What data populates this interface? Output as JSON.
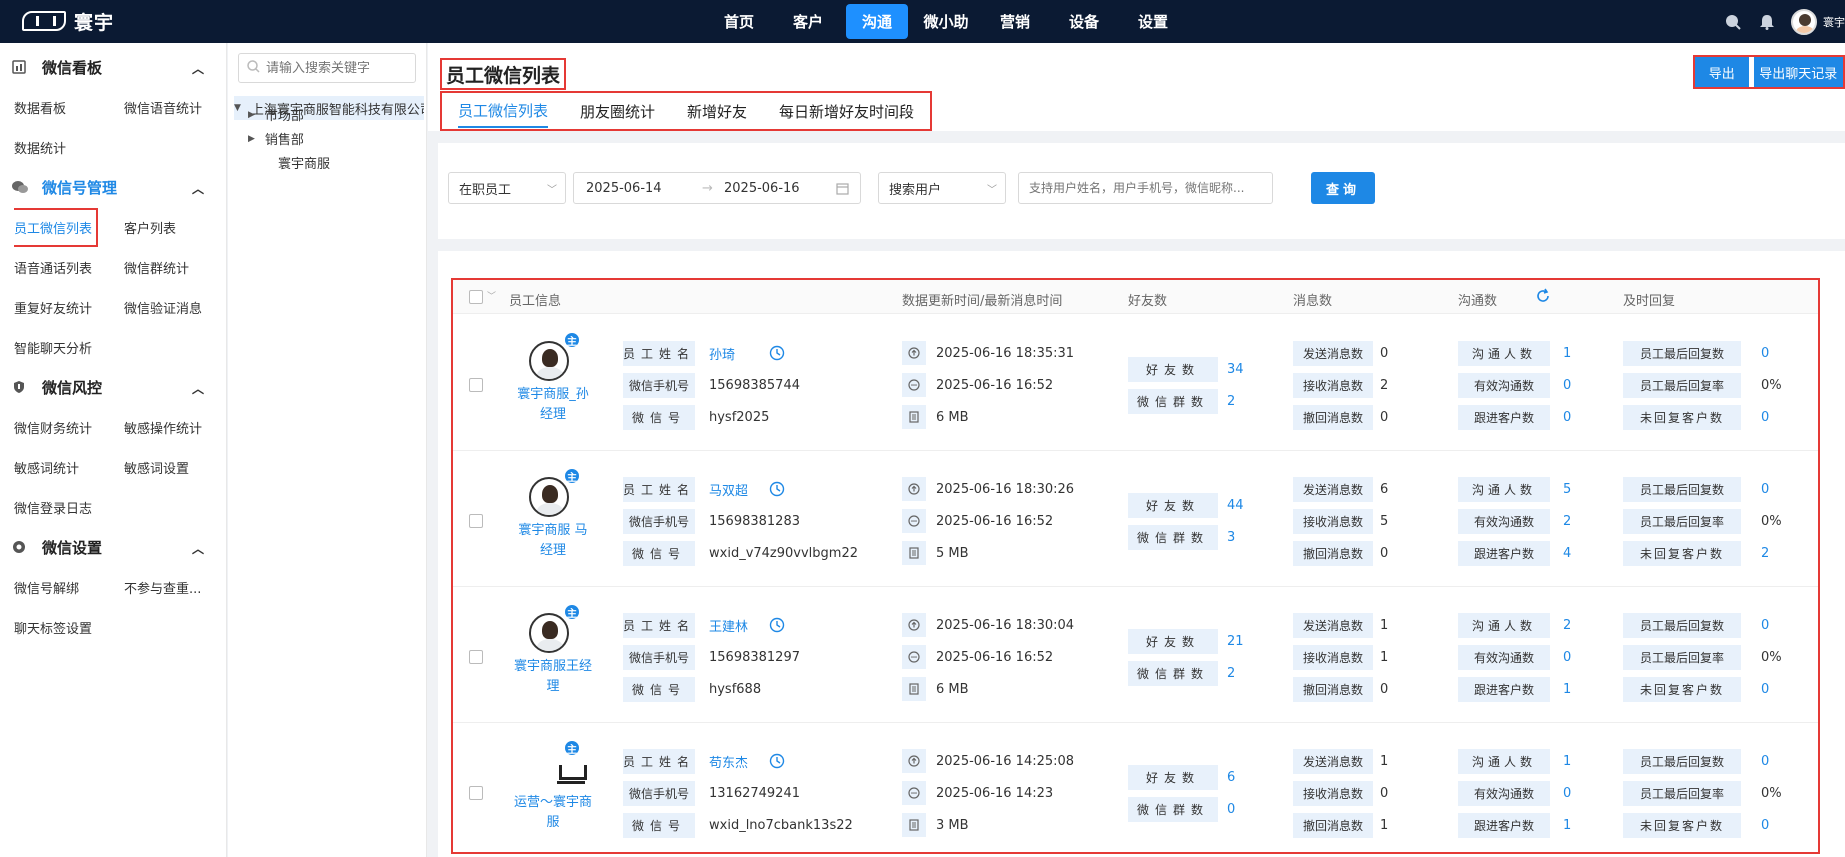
{
  "topnav": {
    "brand": "寰宇",
    "links": [
      "首页",
      "客户",
      "沟通",
      "微小助",
      "营销",
      "设备",
      "设置"
    ],
    "active": "沟通",
    "user": "寰宇商服"
  },
  "sidebar": {
    "sections": [
      {
        "title": "微信看板",
        "items": [
          "数据看板",
          "微信语音统计",
          "数据统计"
        ]
      },
      {
        "title": "微信号管理",
        "items": [
          "员工微信列表",
          "客户列表",
          "语音通话列表",
          "微信群统计",
          "重复好友统计",
          "微信验证消息",
          "智能聊天分析"
        ]
      },
      {
        "title": "微信风控",
        "items": [
          "微信财务统计",
          "敏感操作统计",
          "敏感词统计",
          "敏感词设置",
          "微信登录日志"
        ]
      },
      {
        "title": "微信设置",
        "items": [
          "微信号解绑",
          "不参与查重...",
          "聊天标签设置"
        ]
      }
    ],
    "active_item": "员工微信列表"
  },
  "tree": {
    "search_placeholder": "请输入搜索关键字",
    "root": "上海寰宇商服智能科技有限公司",
    "children": [
      "市场部",
      "销售部",
      "寰宇商服"
    ]
  },
  "page": {
    "title": "员工微信列表",
    "tabs": [
      "员工微信列表",
      "朋友圈统计",
      "新增好友",
      "每日新增好友时间段"
    ],
    "export_label": "导出",
    "export_chat_label": "导出聊天记录"
  },
  "filters": {
    "status": "在职员工",
    "date_start": "2025-06-14",
    "date_end": "2025-06-16",
    "date_sep": "→",
    "search_type": "搜索用户",
    "search_placeholder": "支持用户姓名，用户手机号，微信昵称...",
    "query_label": "查询"
  },
  "table": {
    "headers": [
      "员工信息",
      "数据更新时间/最新消息时间",
      "好友数",
      "消息数",
      "沟通数",
      "及时回复"
    ],
    "labels": {
      "name": "员工姓名",
      "phone": "微信手机号",
      "wxid": "微信号",
      "friends": "好友数",
      "groups": "微信群数",
      "sent": "发送消息数",
      "received": "接收消息数",
      "recalled": "撤回消息数",
      "contacts": "沟通人数",
      "effective": "有效沟通数",
      "followed": "跟进客户数",
      "last_reply": "员工最后回复数",
      "reply_rate": "员工最后回复率",
      "unreplied": "未回复客户数"
    },
    "badge": "主",
    "rows": [
      {
        "nick": "寰宇商服_孙经理",
        "avatar": "person",
        "name": "孙琦",
        "phone": "15698385744",
        "wxid": "hysf2025",
        "updated": "2025-06-16 18:35:31",
        "last_msg": "2025-06-16 16:52",
        "size": "6 MB",
        "friends": "34",
        "groups": "2",
        "sent": "0",
        "received": "2",
        "recalled": "0",
        "contacts": "1",
        "effective": "0",
        "followed": "0",
        "last_reply": "0",
        "reply_rate": "0%",
        "unreplied": "0"
      },
      {
        "nick": "寰宇商服 马经理",
        "avatar": "person",
        "name": "马双超",
        "phone": "15698381283",
        "wxid": "wxid_v74z90vvlbgm22",
        "updated": "2025-06-16 18:30:26",
        "last_msg": "2025-06-16 16:52",
        "size": "5 MB",
        "friends": "44",
        "groups": "3",
        "sent": "6",
        "received": "5",
        "recalled": "0",
        "contacts": "5",
        "effective": "2",
        "followed": "4",
        "last_reply": "0",
        "reply_rate": "0%",
        "unreplied": "2"
      },
      {
        "nick": "寰宇商服王经理",
        "avatar": "person",
        "name": "王建林",
        "phone": "15698381297",
        "wxid": "hysf688",
        "updated": "2025-06-16 18:30:04",
        "last_msg": "2025-06-16 16:52",
        "size": "6 MB",
        "friends": "21",
        "groups": "2",
        "sent": "1",
        "received": "1",
        "recalled": "0",
        "contacts": "2",
        "effective": "0",
        "followed": "1",
        "last_reply": "0",
        "reply_rate": "0%",
        "unreplied": "0"
      },
      {
        "nick": "运营～寰宇商服",
        "avatar": "logo",
        "name": "苟东杰",
        "phone": "13162749241",
        "wxid": "wxid_lno7cbank13s22",
        "updated": "2025-06-16 14:25:08",
        "last_msg": "2025-06-16 14:23",
        "size": "3 MB",
        "friends": "6",
        "groups": "0",
        "sent": "1",
        "received": "0",
        "recalled": "1",
        "contacts": "1",
        "effective": "0",
        "followed": "1",
        "last_reply": "0",
        "reply_rate": "0%",
        "unreplied": "0"
      }
    ]
  },
  "colors": {
    "nav_bg": "#0b1a33",
    "accent": "#1e88e5",
    "highlight": "#e53935"
  }
}
